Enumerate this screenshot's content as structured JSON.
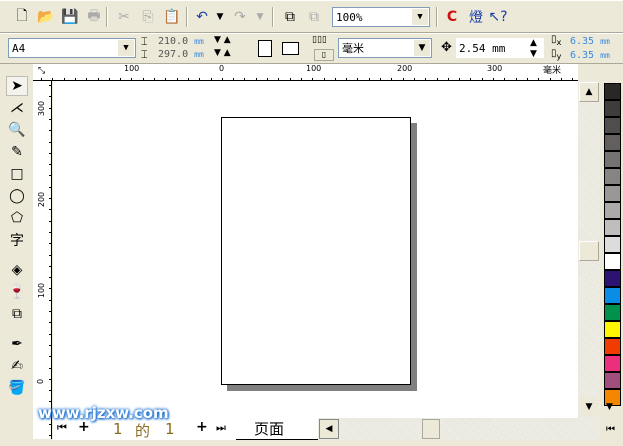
{
  "toolbar": {
    "zoom": "100%"
  },
  "property_bar": {
    "paper_size": "A4",
    "width": "210.0",
    "height": "297.0",
    "size_unit": "mm",
    "units": "毫米",
    "nudge": "2.54 mm",
    "dup_x": "6.35",
    "dup_y": "6.35",
    "dup_unit": "mm",
    "x_label": "x",
    "y_label": "y"
  },
  "rulers": {
    "h_labels": [
      "100",
      "0",
      "100",
      "200",
      "300"
    ],
    "h_unit": "毫米",
    "v_labels": [
      "300",
      "200",
      "100",
      "0"
    ]
  },
  "palette": [
    "#2a2826",
    "#3f3d3b",
    "#504e4c",
    "#625f5d",
    "#757371",
    "#878584",
    "#9a9897",
    "#acaaa9",
    "#bfbebd",
    "#dcdcdc",
    "#ffffff",
    "#2e1271",
    "#0a8ee5",
    "#00924a",
    "#fff500",
    "#f03c00",
    "#ec2f7c",
    "#a04e7c",
    "#f58700"
  ],
  "page_nav": {
    "current": "1",
    "of": "的",
    "total": "1",
    "tab": "页面"
  },
  "watermark": "www.rjzxw.com"
}
